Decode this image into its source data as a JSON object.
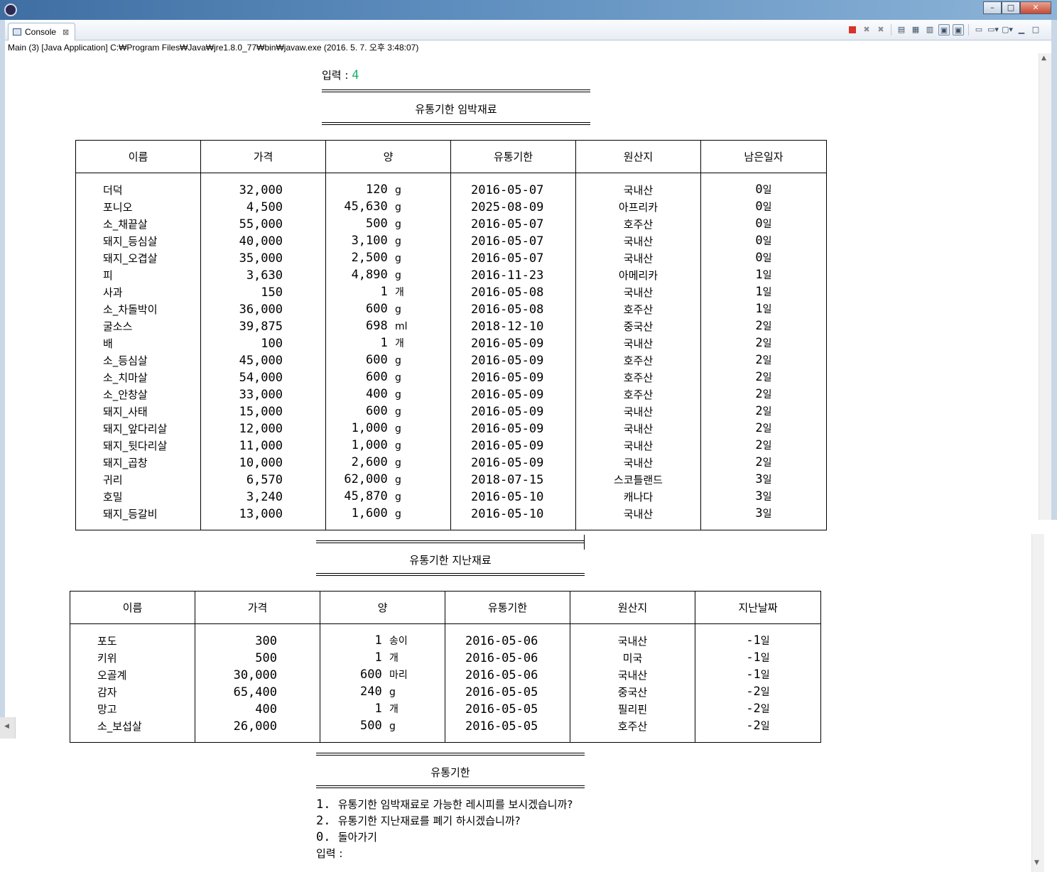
{
  "window": {
    "minimize": "–",
    "maximize": "□",
    "close": "✕"
  },
  "tab": {
    "label": "Console",
    "close": "⊠"
  },
  "process_line": "Main (3) [Java Application] C:₩Program Files₩Java₩jre1.8.0_77₩bin₩javaw.exe (2016. 5. 7. 오후 3:48:07)",
  "toolbar_icons": [
    "terminate-icon",
    "remove-launch-icon",
    "remove-all-icon",
    "clear-console-icon",
    "scroll-lock-icon",
    "word-wrap-icon",
    "show-on-stdout-icon",
    "show-on-stderr-icon",
    "pin-console-icon",
    "display-console-icon",
    "open-console-icon",
    "minimize-view-icon",
    "maximize-view-icon"
  ],
  "colors": {
    "input_value": "#19b36b",
    "title_bar": "#3f6ea3"
  },
  "prompt": {
    "label": "입력 : ",
    "value": "4"
  },
  "expiring": {
    "title": "유통기한 임박재료",
    "headers": [
      "이름",
      "가격",
      "양",
      "유통기한",
      "원산지",
      "남은일자"
    ],
    "rows": [
      {
        "name": "더덕",
        "price": "32,000",
        "qty": "120",
        "unit": "g",
        "date": "2016-05-07",
        "origin": "국내산",
        "days": "0",
        "days_unit": "일"
      },
      {
        "name": "포니오",
        "price": "4,500",
        "qty": "45,630",
        "unit": "g",
        "date": "2025-08-09",
        "origin": "아프리카",
        "days": "0",
        "days_unit": "일"
      },
      {
        "name": "소_채끝살",
        "price": "55,000",
        "qty": "500",
        "unit": "g",
        "date": "2016-05-07",
        "origin": "호주산",
        "days": "0",
        "days_unit": "일"
      },
      {
        "name": "돼지_등심살",
        "price": "40,000",
        "qty": "3,100",
        "unit": "g",
        "date": "2016-05-07",
        "origin": "국내산",
        "days": "0",
        "days_unit": "일"
      },
      {
        "name": "돼지_오겹살",
        "price": "35,000",
        "qty": "2,500",
        "unit": "g",
        "date": "2016-05-07",
        "origin": "국내산",
        "days": "0",
        "days_unit": "일"
      },
      {
        "name": "피",
        "price": "3,630",
        "qty": "4,890",
        "unit": "g",
        "date": "2016-11-23",
        "origin": "아메리카",
        "days": "1",
        "days_unit": "일"
      },
      {
        "name": "사과",
        "price": "150",
        "qty": "1",
        "unit": "개",
        "date": "2016-05-08",
        "origin": "국내산",
        "days": "1",
        "days_unit": "일"
      },
      {
        "name": "소_차돌박이",
        "price": "36,000",
        "qty": "600",
        "unit": "g",
        "date": "2016-05-08",
        "origin": "호주산",
        "days": "1",
        "days_unit": "일"
      },
      {
        "name": "굴소스",
        "price": "39,875",
        "qty": "698",
        "unit": "ml",
        "date": "2018-12-10",
        "origin": "중국산",
        "days": "2",
        "days_unit": "일"
      },
      {
        "name": "배",
        "price": "100",
        "qty": "1",
        "unit": "개",
        "date": "2016-05-09",
        "origin": "국내산",
        "days": "2",
        "days_unit": "일"
      },
      {
        "name": "소_등심살",
        "price": "45,000",
        "qty": "600",
        "unit": "g",
        "date": "2016-05-09",
        "origin": "호주산",
        "days": "2",
        "days_unit": "일"
      },
      {
        "name": "소_치마살",
        "price": "54,000",
        "qty": "600",
        "unit": "g",
        "date": "2016-05-09",
        "origin": "호주산",
        "days": "2",
        "days_unit": "일"
      },
      {
        "name": "소_안창살",
        "price": "33,000",
        "qty": "400",
        "unit": "g",
        "date": "2016-05-09",
        "origin": "호주산",
        "days": "2",
        "days_unit": "일"
      },
      {
        "name": "돼지_사태",
        "price": "15,000",
        "qty": "600",
        "unit": "g",
        "date": "2016-05-09",
        "origin": "국내산",
        "days": "2",
        "days_unit": "일"
      },
      {
        "name": "돼지_앞다리살",
        "price": "12,000",
        "qty": "1,000",
        "unit": "g",
        "date": "2016-05-09",
        "origin": "국내산",
        "days": "2",
        "days_unit": "일"
      },
      {
        "name": "돼지_뒷다리살",
        "price": "11,000",
        "qty": "1,000",
        "unit": "g",
        "date": "2016-05-09",
        "origin": "국내산",
        "days": "2",
        "days_unit": "일"
      },
      {
        "name": "돼지_곱창",
        "price": "10,000",
        "qty": "2,600",
        "unit": "g",
        "date": "2016-05-09",
        "origin": "국내산",
        "days": "2",
        "days_unit": "일"
      },
      {
        "name": "귀리",
        "price": "6,570",
        "qty": "62,000",
        "unit": "g",
        "date": "2018-07-15",
        "origin": "스코틀랜드",
        "days": "3",
        "days_unit": "일"
      },
      {
        "name": "호밀",
        "price": "3,240",
        "qty": "45,870",
        "unit": "g",
        "date": "2016-05-10",
        "origin": "캐나다",
        "days": "3",
        "days_unit": "일"
      },
      {
        "name": "돼지_등갈비",
        "price": "13,000",
        "qty": "1,600",
        "unit": "g",
        "date": "2016-05-10",
        "origin": "국내산",
        "days": "3",
        "days_unit": "일"
      }
    ]
  },
  "expired": {
    "title": "유통기한 지난재료",
    "headers": [
      "이름",
      "가격",
      "양",
      "유통기한",
      "원산지",
      "지난날짜"
    ],
    "rows": [
      {
        "name": "포도",
        "price": "300",
        "qty": "1",
        "unit": "송이",
        "date": "2016-05-06",
        "origin": "국내산",
        "days": "-1",
        "days_unit": "일"
      },
      {
        "name": "키위",
        "price": "500",
        "qty": "1",
        "unit": "개",
        "date": "2016-05-06",
        "origin": "미국",
        "days": "-1",
        "days_unit": "일"
      },
      {
        "name": "오골계",
        "price": "30,000",
        "qty": "600",
        "unit": "마리",
        "date": "2016-05-06",
        "origin": "국내산",
        "days": "-1",
        "days_unit": "일"
      },
      {
        "name": "감자",
        "price": "65,400",
        "qty": "240",
        "unit": "g",
        "date": "2016-05-05",
        "origin": "중국산",
        "days": "-2",
        "days_unit": "일"
      },
      {
        "name": "망고",
        "price": "400",
        "qty": "1",
        "unit": "개",
        "date": "2016-05-05",
        "origin": "필리핀",
        "days": "-2",
        "days_unit": "일"
      },
      {
        "name": "소_보섭살",
        "price": "26,000",
        "qty": "500",
        "unit": "g",
        "date": "2016-05-05",
        "origin": "호주산",
        "days": "-2",
        "days_unit": "일"
      }
    ]
  },
  "menu": {
    "title": "유통기한",
    "options": [
      {
        "num": "1. ",
        "text": "유통기한 임박재료로 가능한 레시피를 보시겠습니까?"
      },
      {
        "num": "2. ",
        "text": "유통기한 지난재료를 폐기 하시겠습니까?"
      },
      {
        "num": "0. ",
        "text": "돌아가기"
      }
    ],
    "prompt": "입력 : "
  }
}
